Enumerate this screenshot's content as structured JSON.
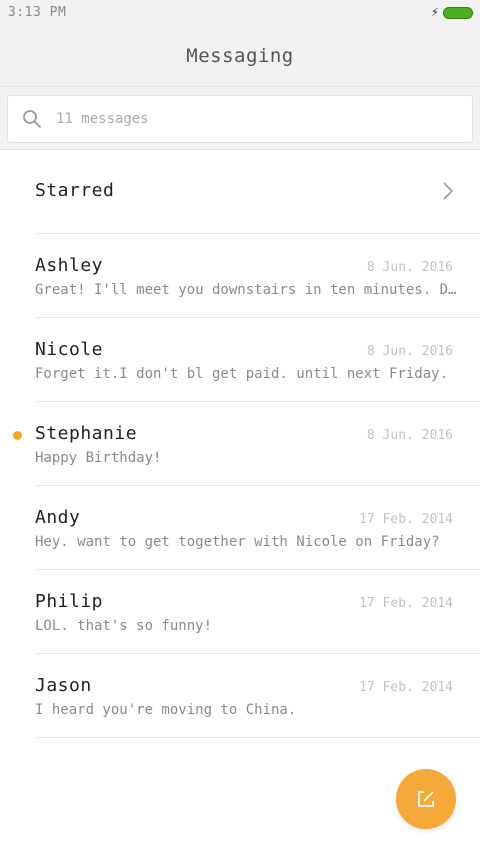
{
  "status_bar": {
    "time": "3:13 PM"
  },
  "header": {
    "title": "Messaging"
  },
  "search": {
    "placeholder": "11 messages"
  },
  "starred": {
    "label": "Starred"
  },
  "conversations": [
    {
      "name": "Ashley",
      "date": "8 Jun. 2016",
      "preview": "Great! I'll meet you downstairs in ten minutes. Don't...",
      "unread": false
    },
    {
      "name": "Nicole",
      "date": "8 Jun. 2016",
      "preview": "Forget it.I don't bl get paid. until next Friday.",
      "unread": false
    },
    {
      "name": "Stephanie",
      "date": "8 Jun. 2016",
      "preview": "Happy Birthday!",
      "unread": true
    },
    {
      "name": "Andy",
      "date": "17 Feb. 2014",
      "preview": "Hey. want to get together with Nicole on Friday?",
      "unread": false
    },
    {
      "name": "Philip",
      "date": "17 Feb. 2014",
      "preview": "LOL. that's so funny!",
      "unread": false
    },
    {
      "name": "Jason",
      "date": "17 Feb. 2014",
      "preview": "I heard you're moving to China.",
      "unread": false
    }
  ],
  "colors": {
    "accent": "#f5a623",
    "battery": "#4caf1f"
  },
  "icons": {
    "search": "search-icon",
    "chevron": "chevron-right-icon",
    "compose": "compose-icon"
  }
}
